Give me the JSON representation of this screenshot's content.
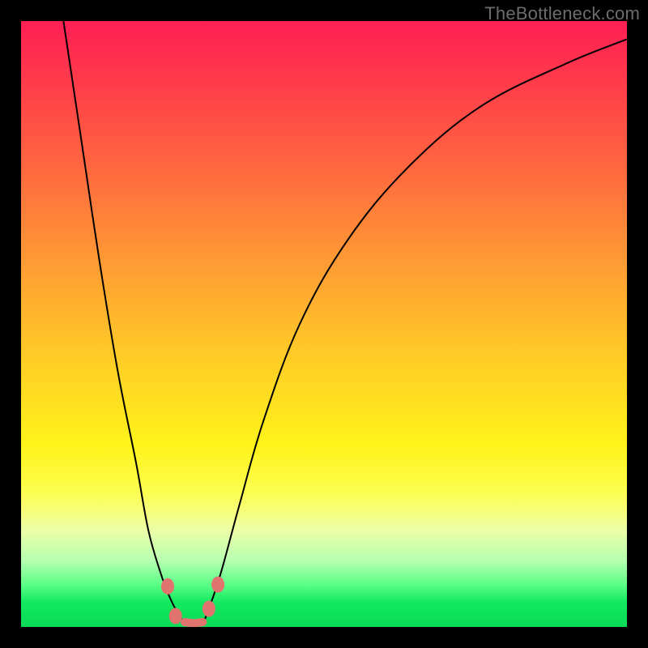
{
  "watermark": {
    "text": "TheBottleneck.com"
  },
  "chart_data": {
    "type": "line",
    "title": "",
    "xlabel": "",
    "ylabel": "",
    "xlim": [
      0,
      100
    ],
    "ylim": [
      0,
      100
    ],
    "series": [
      {
        "name": "left-curve",
        "x": [
          7,
          10,
          13,
          16,
          19,
          21,
          23,
          24.5,
          26,
          27
        ],
        "y": [
          100,
          80,
          60,
          42,
          27,
          16,
          9,
          5,
          2,
          0.5
        ]
      },
      {
        "name": "right-curve",
        "x": [
          30,
          31,
          33,
          36,
          40,
          46,
          54,
          64,
          76,
          90,
          100
        ],
        "y": [
          0.5,
          3,
          9,
          20,
          34,
          50,
          64,
          76,
          86,
          93,
          97
        ]
      }
    ],
    "markers": [
      {
        "name": "bead-left-upper",
        "x": 24.2,
        "y": 6.7
      },
      {
        "name": "bead-right-upper",
        "x": 32.5,
        "y": 7.0
      },
      {
        "name": "bead-right-mid",
        "x": 31.0,
        "y": 3.0
      },
      {
        "name": "bead-left-lower",
        "x": 25.5,
        "y": 1.8
      },
      {
        "name": "bead-valley-1",
        "x": 27.0,
        "y": 0.8
      },
      {
        "name": "bead-valley-2",
        "x": 28.5,
        "y": 0.6
      },
      {
        "name": "bead-valley-3",
        "x": 30.0,
        "y": 0.8
      }
    ],
    "gradient_stops": [
      {
        "pct": 0,
        "color": "#ff1f54"
      },
      {
        "pct": 50,
        "color": "#ffb728"
      },
      {
        "pct": 75,
        "color": "#fff31a"
      },
      {
        "pct": 95,
        "color": "#1fe864"
      },
      {
        "pct": 100,
        "color": "#0adb57"
      }
    ]
  }
}
